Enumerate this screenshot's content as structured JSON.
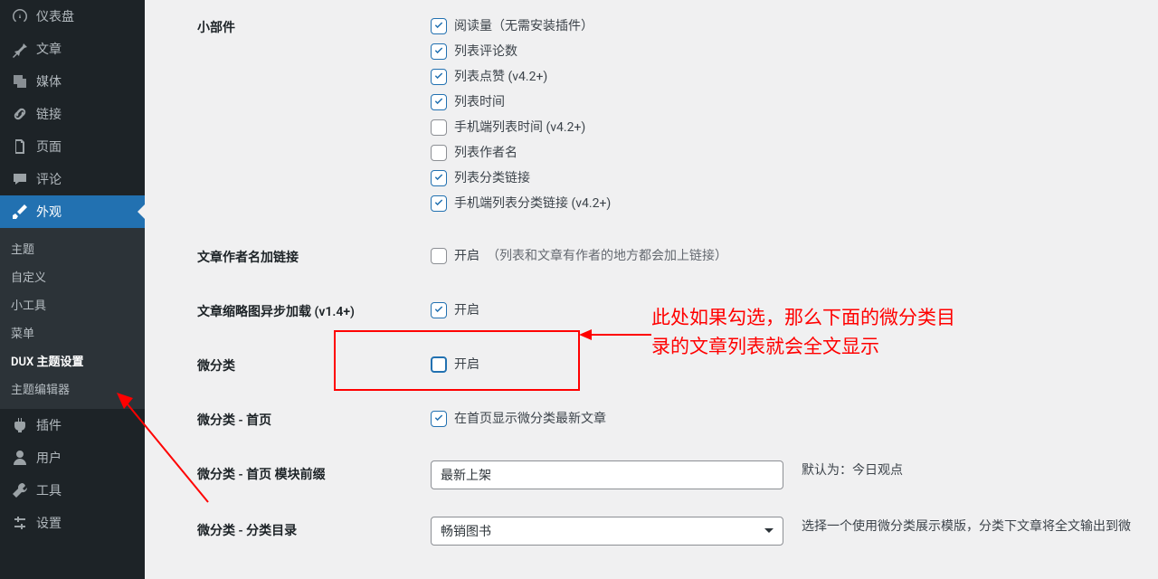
{
  "sidebar": {
    "items": [
      {
        "label": "仪表盘",
        "icon": "dashboard"
      },
      {
        "label": "文章",
        "icon": "pin"
      },
      {
        "label": "媒体",
        "icon": "media"
      },
      {
        "label": "链接",
        "icon": "link"
      },
      {
        "label": "页面",
        "icon": "page"
      },
      {
        "label": "评论",
        "icon": "comment"
      },
      {
        "label": "外观",
        "icon": "brush",
        "active": true
      },
      {
        "label": "插件",
        "icon": "plugin"
      },
      {
        "label": "用户",
        "icon": "user"
      },
      {
        "label": "工具",
        "icon": "tool"
      },
      {
        "label": "设置",
        "icon": "settings"
      }
    ],
    "submenu": [
      {
        "label": "主题"
      },
      {
        "label": "自定义"
      },
      {
        "label": "小工具"
      },
      {
        "label": "菜单"
      },
      {
        "label": "DUX 主题设置",
        "current": true
      },
      {
        "label": "主题编辑器"
      }
    ]
  },
  "form": {
    "widgets_label": "小部件",
    "widgets": [
      {
        "label": "阅读量（无需安装插件）",
        "checked": true
      },
      {
        "label": "列表评论数",
        "checked": true
      },
      {
        "label": "列表点赞 (v4.2+)",
        "checked": true
      },
      {
        "label": "列表时间",
        "checked": true
      },
      {
        "label": "手机端列表时间 (v4.2+)",
        "checked": false
      },
      {
        "label": "列表作者名",
        "checked": false
      },
      {
        "label": "列表分类链接",
        "checked": true
      },
      {
        "label": "手机端列表分类链接 (v4.2+)",
        "checked": true
      }
    ],
    "author_link_label": "文章作者名加链接",
    "author_link_chk": "开启",
    "author_link_hint": "（列表和文章有作者的地方都会加上链接）",
    "thumb_async_label": "文章缩略图异步加载 (v1.4+)",
    "thumb_async_chk": "开启",
    "micro_label": "微分类",
    "micro_chk": "开启",
    "micro_home_label": "微分类 - 首页",
    "micro_home_chk": "在首页显示微分类最新文章",
    "micro_prefix_label": "微分类 - 首页 模块前缀",
    "micro_prefix_value": "最新上架",
    "micro_prefix_hint": "默认为：今日观点",
    "micro_cat_label": "微分类 - 分类目录",
    "micro_cat_value": "畅销图书",
    "micro_cat_hint": "选择一个使用微分类展示模版，分类下文章将全文输出到微"
  },
  "annotation": {
    "line1": "此处如果勾选，那么下面的微分类目",
    "line2": "录的文章列表就会全文显示"
  }
}
